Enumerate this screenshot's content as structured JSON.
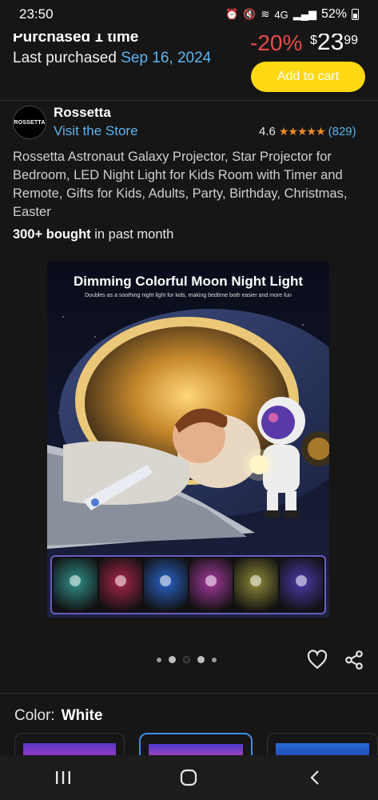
{
  "status_bar": {
    "time": "23:50",
    "network": "4G",
    "battery": "52%"
  },
  "purchase": {
    "purchased_times": "Purchased 1 time",
    "last_purchased_label": "Last purchased",
    "last_purchased_date": "Sep 16, 2024",
    "discount": "-20%",
    "price_currency": "$",
    "price_whole": "23",
    "price_fraction": "99",
    "add_to_cart": "Add to cart"
  },
  "seller": {
    "logo_text": "ROSSETTA",
    "name": "Rossetta",
    "visit_store": "Visit the Store",
    "rating_value": "4.6",
    "stars": 4.6,
    "rating_count": "(829)"
  },
  "product": {
    "title": "Rossetta Astronaut Galaxy Projector, Star Projector for Bedroom, LED Night Light for Kids Room with Timer and Remote, Gifts for Kids, Adults, Party, Birthday, Christmas, Easter",
    "bought_bold": "300+ bought",
    "bought_rest": " in past month",
    "image_title": "Dimming Colorful Moon Night Light",
    "image_subtitle": "Doubles as a soothing night light for kids, making bedtime both easier and more fun",
    "thumb_colors": [
      "#2f8f88",
      "#a8254a",
      "#2a64c8",
      "#a43a9c",
      "#8e8a38",
      "#4c3aa8"
    ],
    "carousel_dots": 5,
    "carousel_active": 2
  },
  "color_selector": {
    "label": "Color:",
    "value": "White"
  },
  "colors": {
    "accent_link": "#5fb3ef",
    "add_to_cart_bg": "#ffd814",
    "discount": "#e54b4b",
    "star": "#f08a24"
  }
}
